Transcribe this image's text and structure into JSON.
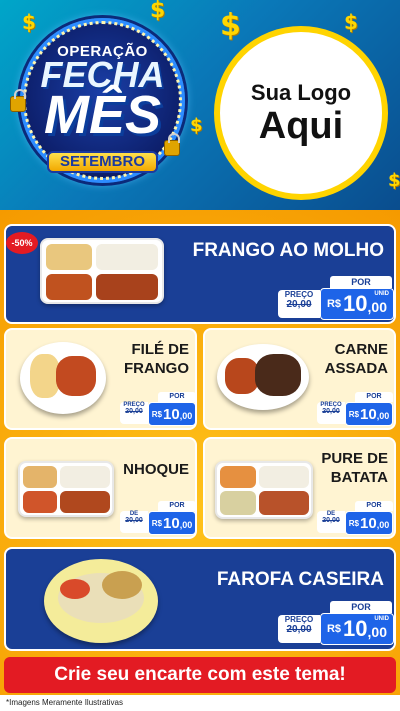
{
  "header": {
    "badge_line1": "OPERAÇÃO",
    "badge_line2": "FECHA",
    "badge_line3": "MÊS",
    "badge_month": "SETEMBRO",
    "logo_line1": "Sua Logo",
    "logo_line2": "Aqui",
    "dollar_symbol": "$"
  },
  "discount_badge": "-50%",
  "price_labels": {
    "por": "POR",
    "preco": "PREÇO",
    "de": "DE",
    "currency": "R$",
    "unid": "UNID"
  },
  "products": [
    {
      "name": "FRANGO AO MOLHO",
      "old_price": "20,00",
      "price_int": "10",
      "price_dec": ",00"
    },
    {
      "name_l1": "FILÉ DE",
      "name_l2": "FRANGO",
      "old_price": "20,00",
      "price_int": "10",
      "price_dec": ",00"
    },
    {
      "name_l1": "CARNE",
      "name_l2": "ASSADA",
      "old_price": "20,00",
      "price_int": "10",
      "price_dec": ",00"
    },
    {
      "name": "NHOQUE",
      "old_price": "20,00",
      "price_int": "10",
      "price_dec": ",00"
    },
    {
      "name_l1": "PURE DE",
      "name_l2": "BATATA",
      "old_price": "20,00",
      "price_int": "10",
      "price_dec": ",00"
    },
    {
      "name": "FAROFA CASEIRA",
      "old_price": "20,00",
      "price_int": "10",
      "price_dec": ",00"
    }
  ],
  "cta": "Crie seu encarte com este tema!",
  "footnote": "*Imagens Meramente Ilustrativas",
  "colors": {
    "navy": "#1a3f96",
    "price_blue": "#1e64e8",
    "cta_red": "#e31b23",
    "orange_bg": "#f6a500",
    "gold": "#ffd400"
  }
}
